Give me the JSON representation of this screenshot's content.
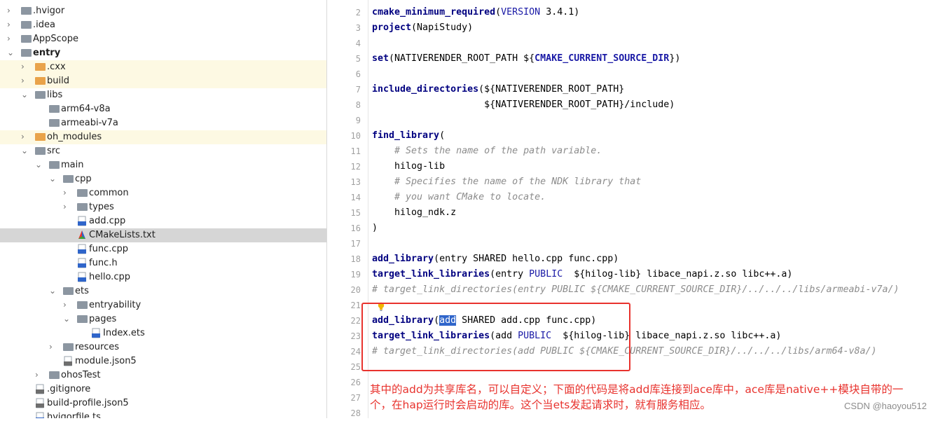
{
  "project_tree": [
    {
      "label": ".hvigor",
      "depth": 0,
      "expanded": false,
      "icon": "folder-gray-icon",
      "bold": false
    },
    {
      "label": ".idea",
      "depth": 0,
      "expanded": false,
      "icon": "folder-gray-icon",
      "bold": false
    },
    {
      "label": "AppScope",
      "depth": 0,
      "expanded": false,
      "icon": "folder-gray-icon",
      "bold": false
    },
    {
      "label": "entry",
      "depth": 0,
      "expanded": true,
      "icon": "folder-module-icon",
      "bold": true
    },
    {
      "label": ".cxx",
      "depth": 1,
      "expanded": false,
      "icon": "folder-orange-icon",
      "bold": false,
      "highlight": "yellow"
    },
    {
      "label": "build",
      "depth": 1,
      "expanded": false,
      "icon": "folder-orange-icon",
      "bold": false,
      "highlight": "yellow"
    },
    {
      "label": "libs",
      "depth": 1,
      "expanded": true,
      "icon": "folder-gray-icon",
      "bold": false
    },
    {
      "label": "arm64-v8a",
      "depth": 2,
      "icon": "folder-gray-icon",
      "bold": false
    },
    {
      "label": "armeabi-v7a",
      "depth": 2,
      "icon": "folder-gray-icon",
      "bold": false
    },
    {
      "label": "oh_modules",
      "depth": 1,
      "expanded": false,
      "icon": "folder-orange-icon",
      "bold": false,
      "highlight": "yellow"
    },
    {
      "label": "src",
      "depth": 1,
      "expanded": true,
      "icon": "folder-gray-icon",
      "bold": false
    },
    {
      "label": "main",
      "depth": 2,
      "expanded": true,
      "icon": "folder-gray-icon",
      "bold": false
    },
    {
      "label": "cpp",
      "depth": 3,
      "expanded": true,
      "icon": "folder-gray-icon",
      "bold": false
    },
    {
      "label": "common",
      "depth": 4,
      "expanded": false,
      "icon": "folder-gray-icon",
      "bold": false
    },
    {
      "label": "types",
      "depth": 4,
      "expanded": false,
      "icon": "folder-gray-icon",
      "bold": false
    },
    {
      "label": "add.cpp",
      "depth": 4,
      "icon": "cpp-file-icon",
      "bold": false
    },
    {
      "label": "CMakeLists.txt",
      "depth": 4,
      "icon": "cmake-file-icon",
      "bold": false,
      "highlight": "selected"
    },
    {
      "label": "func.cpp",
      "depth": 4,
      "icon": "cpp-file-icon",
      "bold": false
    },
    {
      "label": "func.h",
      "depth": 4,
      "icon": "header-file-icon",
      "bold": false
    },
    {
      "label": "hello.cpp",
      "depth": 4,
      "icon": "cpp-file-icon",
      "bold": false
    },
    {
      "label": "ets",
      "depth": 3,
      "expanded": true,
      "icon": "folder-gray-icon",
      "bold": false
    },
    {
      "label": "entryability",
      "depth": 4,
      "expanded": false,
      "icon": "folder-gray-icon",
      "bold": false
    },
    {
      "label": "pages",
      "depth": 4,
      "expanded": true,
      "icon": "folder-gray-icon",
      "bold": false
    },
    {
      "label": "Index.ets",
      "depth": 5,
      "icon": "ets-file-icon",
      "bold": false
    },
    {
      "label": "resources",
      "depth": 3,
      "expanded": false,
      "icon": "folder-gray-icon",
      "bold": false
    },
    {
      "label": "module.json5",
      "depth": 3,
      "icon": "json-file-icon",
      "bold": false
    },
    {
      "label": "ohosTest",
      "depth": 2,
      "expanded": false,
      "icon": "folder-gray-icon",
      "bold": false
    },
    {
      "label": ".gitignore",
      "depth": 1,
      "icon": "text-file-icon",
      "bold": false
    },
    {
      "label": "build-profile.json5",
      "depth": 1,
      "icon": "json-file-icon",
      "bold": false
    },
    {
      "label": "hvigorfile.ts",
      "depth": 1,
      "icon": "ts-file-icon",
      "bold": false
    }
  ],
  "editor": {
    "line_numbers": [
      "2",
      "3",
      "4",
      "5",
      "6",
      "7",
      "8",
      "9",
      "10",
      "11",
      "12",
      "13",
      "14",
      "15",
      "16",
      "17",
      "18",
      "19",
      "20",
      "21",
      "22",
      "23",
      "24",
      "25",
      "26",
      "27",
      "28"
    ],
    "lines": {
      "l2a": "cmake_minimum_required",
      "l2b": "(",
      "l2c": "VERSION",
      "l2d": " 3.4.1)",
      "l3a": "project",
      "l3b": "(NapiStudy)",
      "l5a": "set",
      "l5b": "(NATIVERENDER_ROOT_PATH ${",
      "l5c": "CMAKE_CURRENT_SOURCE_DIR",
      "l5d": "})",
      "l7a": "include_directories",
      "l7b": "(${NATIVERENDER_ROOT_PATH}",
      "l8": "                    ${NATIVERENDER_ROOT_PATH}/include)",
      "l10a": "find_library",
      "l10b": "(",
      "l11": "    # Sets the name of the path variable.",
      "l12": "    hilog-lib",
      "l13": "    # Specifies the name of the NDK library that",
      "l14": "    # you want CMake to locate.",
      "l15": "    hilog_ndk.z",
      "l16": ")",
      "l18a": "add_library",
      "l18b": "(entry SHARED hello.cpp func.cpp)",
      "l19a": "target_link_libraries",
      "l19b": "(entry ",
      "l19c": "PUBLIC",
      "l19d": "  ${hilog-lib} libace_napi.z.so libc++.a)",
      "l20": "# target_link_directories(entry PUBLIC ${CMAKE_CURRENT_SOURCE_DIR}/../../../libs/armeabi-v7a/)",
      "l22a": "add_library",
      "l22b": "(",
      "l22c": "add",
      "l22d": " SHARED add.cpp func.cpp)",
      "l23a": "target_link_libraries",
      "l23b": "(add ",
      "l23c": "PUBLIC",
      "l23d": "  ${hilog-lib} libace_napi.z.so libc++.a)",
      "l24": "# target_link_directories(add PUBLIC ${CMAKE_CURRENT_SOURCE_DIR}/../../../libs/arm64-v8a/)"
    }
  },
  "annotation": {
    "text": "其中的add为共享库名，可以自定义；下面的代码是将add库连接到ace库中，ace库是native++模块自带的一个，在hap运行时会启动的库。这个当ets发起请求时，就有服务相应。",
    "color": "#e8332e"
  },
  "watermark": "CSDN @haoyou512"
}
